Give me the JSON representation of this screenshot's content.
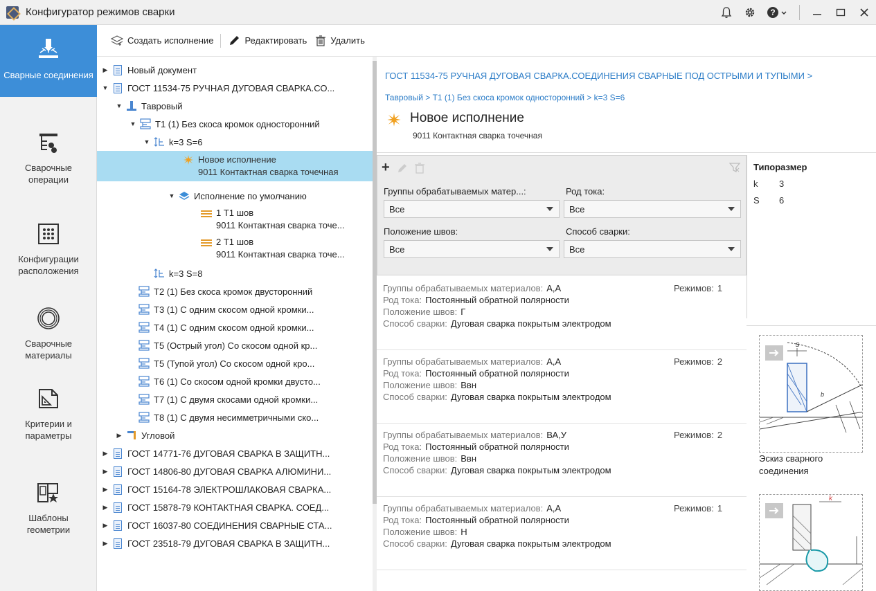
{
  "window": {
    "title": "Конфигуратор режимов сварки"
  },
  "nav": [
    {
      "label": "Сварные соединения",
      "active": true,
      "icon": "welding-joint-icon"
    },
    {
      "label": "Сварочные операции",
      "active": false,
      "icon": "operations-icon"
    },
    {
      "label": "Конфигурации расположения",
      "active": false,
      "icon": "layout-grid-icon"
    },
    {
      "label": "Сварочные материалы",
      "active": false,
      "icon": "wire-coil-icon"
    },
    {
      "label": "Критерии и параметры",
      "active": false,
      "icon": "criteria-icon"
    },
    {
      "label": "Шаблоны геометрии",
      "active": false,
      "icon": "geometry-template-icon"
    }
  ],
  "toolbar": {
    "create_label": "Создать исполнение",
    "edit_label": "Редактировать",
    "delete_label": "Удалить"
  },
  "tree": {
    "r0": "Новый документ",
    "r1": "ГОСТ 11534-75 РУЧНАЯ ДУГОВАЯ СВАРКА.СО...",
    "r2": "Тавровый",
    "r3": "Т1 (1) Без скоса кромок односторонний",
    "r4": "k=3 S=6",
    "r5a": "Новое исполнение",
    "r5b": "9011 Контактная сварка точечная",
    "r6": "Исполнение по умолчанию",
    "r7a": "1 Т1 шов",
    "r7b": "9011 Контактная сварка точе...",
    "r8a": "2 Т1 шов",
    "r8b": "9011 Контактная сварка точе...",
    "r9": "k=3 S=8",
    "r10": "Т2 (1) Без скоса кромок двусторонний",
    "r11": "Т3 (1) С одним скосом одной кромки...",
    "r12": "Т4 (1) С одним скосом одной кромки...",
    "r13": "Т5 (Острый угол) Со скосом одной кр...",
    "r14": "Т5 (Тупой угол) Со скосом одной кро...",
    "r15": "Т6 (1) Со скосом одной кромки двусто...",
    "r16": "Т7 (1) С двумя скосами одной кромки...",
    "r17": "Т8 (1) С двумя несимметричными ско...",
    "r18": "Угловой",
    "r19": "ГОСТ 14771-76 ДУГОВАЯ СВАРКА В ЗАЩИТН...",
    "r20": "ГОСТ 14806-80 ДУГОВАЯ СВАРКА АЛЮМИНИ...",
    "r21": "ГОСТ 15164-78 ЭЛЕКТРОШЛАКОВАЯ СВАРКА...",
    "r22": "ГОСТ 15878-79 КОНТАКТНАЯ СВАРКА. СОЕД...",
    "r23": "ГОСТ 16037-80 СОЕДИНЕНИЯ СВАРНЫЕ СТА...",
    "r24": "ГОСТ 23518-79 ДУГОВАЯ СВАРКА В ЗАЩИТН..."
  },
  "detail": {
    "breadcrumb_top": "ГОСТ 11534-75 РУЧНАЯ ДУГОВАЯ СВАРКА.СОЕДИНЕНИЯ СВАРНЫЕ ПОД ОСТРЫМИ И ТУПЫМИ >",
    "breadcrumb_sub": "Тавровый > Т1 (1) Без скоса кромок односторонний > k=3 S=6",
    "title": "Новое исполнение",
    "subtitle": "9011 Контактная сварка точечная"
  },
  "filters": {
    "materials_label": "Группы обрабатываемых матер...:",
    "materials_value": "Все",
    "current_label": "Род тока:",
    "current_value": "Все",
    "position_label": "Положение швов:",
    "position_value": "Все",
    "method_label": "Способ сварки:",
    "method_value": "Все"
  },
  "card_keys": {
    "materials": "Группы обрабатываемых материалов:",
    "current": "Род тока:",
    "position": "Положение швов:",
    "method": "Способ сварки:",
    "regimes": "Режимов:"
  },
  "cards": [
    {
      "materials": "А,А",
      "current": "Постоянный обратной полярности",
      "position": "Г",
      "method": "Дуговая сварка покрытым электродом",
      "regimes": "1"
    },
    {
      "materials": "А,А",
      "current": "Постоянный обратной полярности",
      "position": "Ввн",
      "method": "Дуговая сварка покрытым электродом",
      "regimes": "2"
    },
    {
      "materials": "ВА,У",
      "current": "Постоянный обратной полярности",
      "position": "Ввн",
      "method": "Дуговая сварка покрытым электродом",
      "regimes": "2"
    },
    {
      "materials": "А,А",
      "current": "Постоянный обратной полярности",
      "position": "Н",
      "method": "Дуговая сварка покрытым электродом",
      "regimes": "1"
    }
  ],
  "typesize": {
    "title": "Типоразмер",
    "k_name": "k",
    "k_value": "3",
    "s_name": "S",
    "s_value": "6"
  },
  "sketch": {
    "caption": "Эскиз сварного соединения",
    "dim_s": "s",
    "dim_b": "b",
    "dim_k": "k"
  },
  "colors": {
    "accent": "#3d8ed8",
    "selection": "#a9dcf2",
    "link": "#2b7cc7",
    "warning_icon": "#f0a020"
  }
}
